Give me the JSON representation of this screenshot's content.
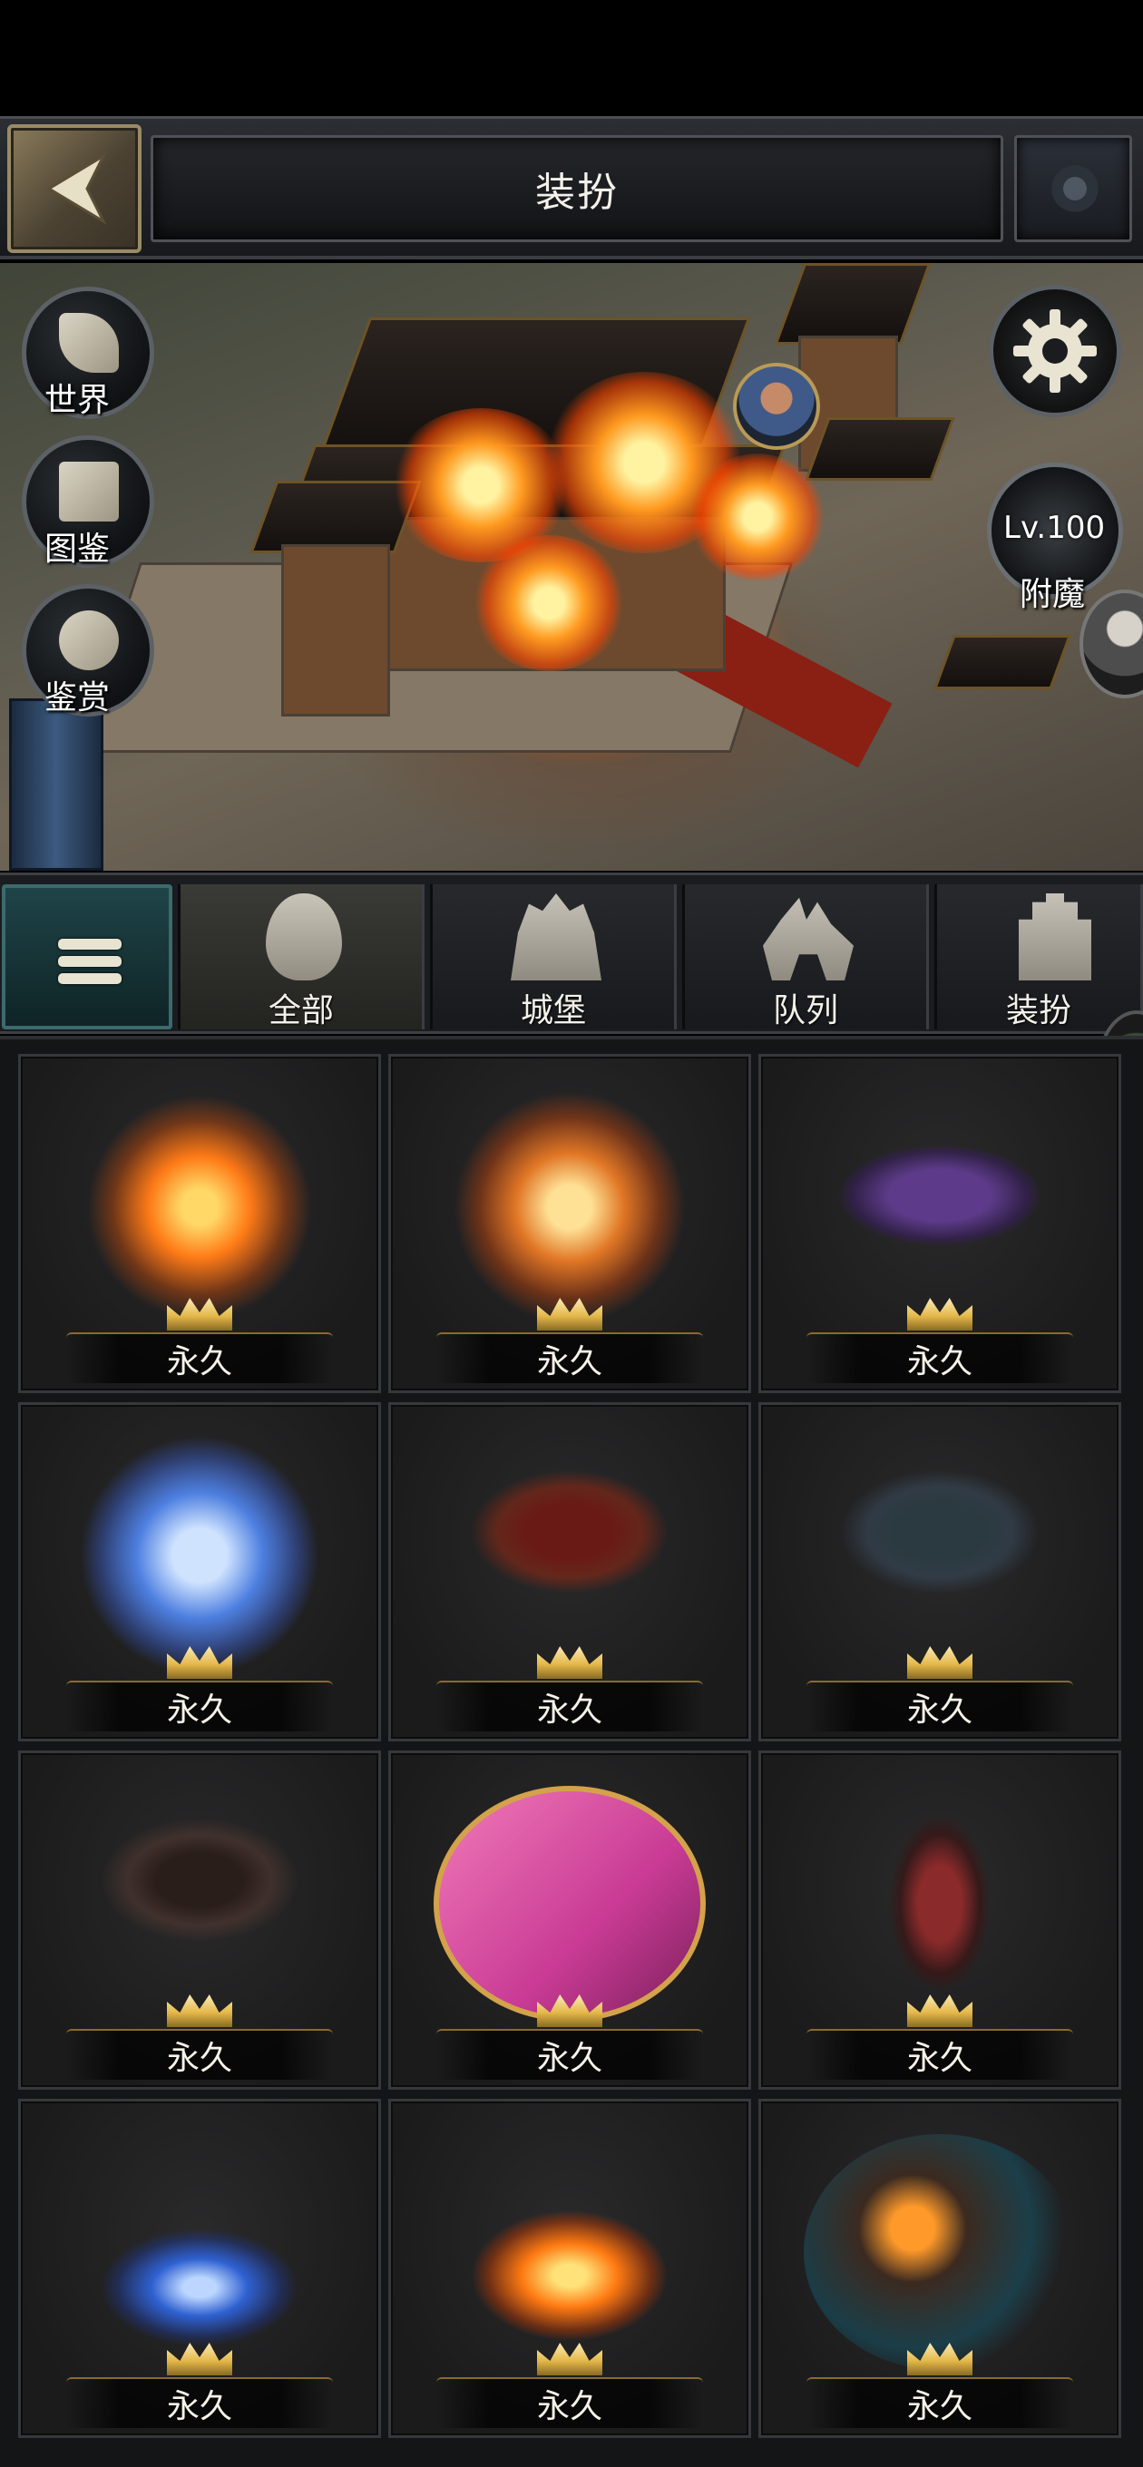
{
  "header": {
    "title": "装扮"
  },
  "scene": {
    "side_buttons": [
      {
        "label": "世界",
        "icon": "world-map-icon"
      },
      {
        "label": "图鉴",
        "icon": "scroll-icon"
      },
      {
        "label": "鉴赏",
        "icon": "appraise-icon"
      }
    ],
    "level_badge": "Lv.100",
    "enchant_label": "附魔",
    "settings_icon": "gear-icon"
  },
  "tabs": [
    {
      "label": "全部",
      "icon": "bag-icon",
      "active": true
    },
    {
      "label": "城堡",
      "icon": "castle-icon",
      "active": false
    },
    {
      "label": "队列",
      "icon": "army-icon",
      "active": false
    },
    {
      "label": "装扮",
      "icon": "decoration-icon",
      "active": false
    }
  ],
  "items": [
    {
      "label": "永久",
      "art": "fire-ring-decoration"
    },
    {
      "label": "永久",
      "art": "golden-scorpion-decoration"
    },
    {
      "label": "永久",
      "art": "dark-wings-decoration"
    },
    {
      "label": "永久",
      "art": "ice-castle-decoration"
    },
    {
      "label": "永久",
      "art": "golden-claw-arrow-decoration"
    },
    {
      "label": "永久",
      "art": "silver-claw-arrow-decoration"
    },
    {
      "label": "永久",
      "art": "bone-claw-arrow-decoration"
    },
    {
      "label": "永久",
      "art": "valentine-frame-decoration"
    },
    {
      "label": "永久",
      "art": "reaper-decoration"
    },
    {
      "label": "永久",
      "art": "blue-portal-decoration"
    },
    {
      "label": "永久",
      "art": "orange-portal-decoration"
    },
    {
      "label": "永久",
      "art": "pumpkin-rider-decoration"
    }
  ],
  "colors": {
    "accent_gold": "#e4b84a",
    "panel_bg": "#1b1b1c",
    "menu_teal": "#1f4448"
  }
}
